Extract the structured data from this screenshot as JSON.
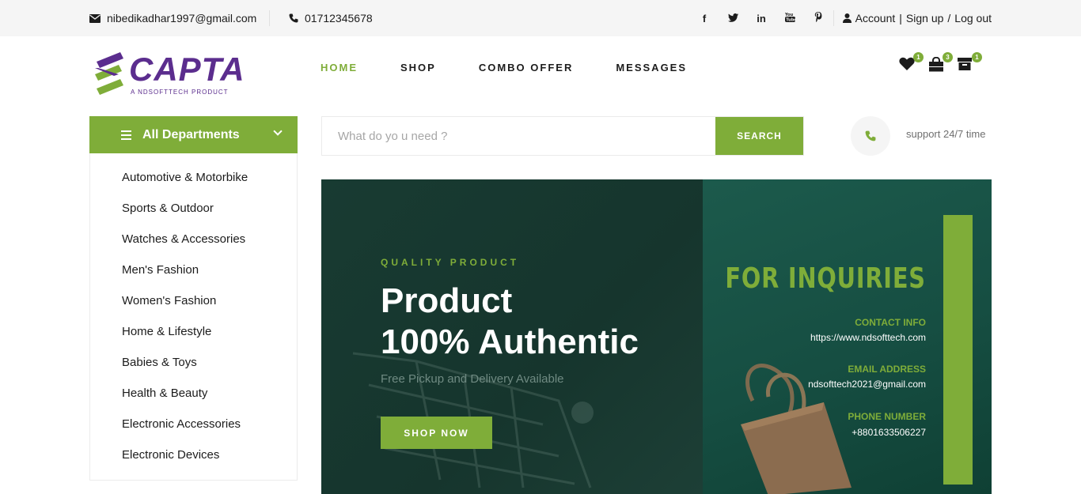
{
  "topbar": {
    "email": "nibedikadhar1997@gmail.com",
    "phone": "01712345678",
    "social": [
      "f",
      "t",
      "in",
      "yt",
      "p"
    ],
    "account_label": "Account",
    "separator": "|",
    "signup_label": "Sign up",
    "slash": "/",
    "logout_label": "Log out"
  },
  "logo": {
    "name": "CAPTA",
    "tagline": "A NDSOFTTECH PRODUCT"
  },
  "nav": {
    "items": [
      {
        "label": "HOME",
        "active": true
      },
      {
        "label": "SHOP"
      },
      {
        "label": "COMBO OFFER"
      },
      {
        "label": "MESSAGES"
      }
    ]
  },
  "header_icons": {
    "wishlist_count": "1",
    "cart_count": "3",
    "orders_count": "1"
  },
  "departments": {
    "title": "All Departments",
    "items": [
      "Automotive & Motorbike",
      "Sports & Outdoor",
      "Watches & Accessories",
      "Men's Fashion",
      "Women's Fashion",
      "Home & Lifestyle",
      "Babies & Toys",
      "Health & Beauty",
      "Electronic Accessories",
      "Electronic Devices"
    ]
  },
  "search": {
    "placeholder": "What do yo u need ?",
    "button_label": "SEARCH"
  },
  "support": {
    "text": "support 24/7 time"
  },
  "hero": {
    "kicker": "QUALITY PRODUCT",
    "title_line1": "Product",
    "title_line2": "100% Authentic",
    "subtitle": "Free Pickup and Delivery Available",
    "button_label": "SHOP NOW",
    "inquiries_title": "FOR INQUIRIES",
    "contact_label": "CONTACT INFO",
    "contact_value": "https://www.ndsofttech.com",
    "email_label": "EMAIL ADDRESS",
    "email_value": "ndsofttech2021@gmail.com",
    "phone_label": "PHONE NUMBER",
    "phone_value": "+8801633506227"
  },
  "colors": {
    "accent": "#7fad39",
    "brand": "#5b2d8e",
    "hero_bg": "#17372e"
  }
}
